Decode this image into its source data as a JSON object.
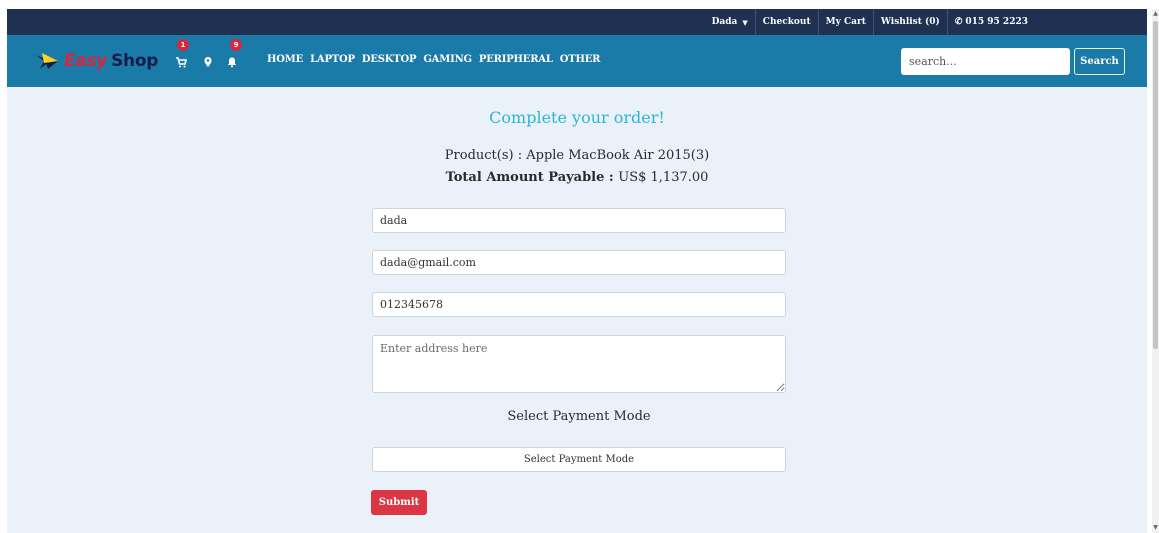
{
  "topbar": {
    "user_label": "Dada",
    "checkout_label": "Checkout",
    "mycart_label": "My Cart",
    "wishlist_label": "Wishlist (0)",
    "phone_label": "015 95 2223"
  },
  "navbar": {
    "logo_easy": "Easy",
    "logo_shop": "Shop",
    "cart_badge": "1",
    "notification_badge": "9",
    "links": [
      "HOME",
      "LAPTOP",
      "DESKTOP",
      "GAMING",
      "PERIPHERAL",
      "OTHER"
    ],
    "search_placeholder": "search...",
    "search_button": "Search"
  },
  "order": {
    "title": "Complete your order!",
    "product_prefix": "Product(s) : ",
    "product_value": "Apple MacBook Air 2015(3)",
    "total_label": "Total Amount Payable : ",
    "total_value": "US$ 1,137.00",
    "name_value": "dada",
    "email_value": "dada@gmail.com",
    "phone_value": "012345678",
    "address_placeholder": "Enter address here",
    "payment_heading": "Select Payment Mode",
    "payment_select": "Select Payment Mode",
    "submit_label": "Submit"
  },
  "colors": {
    "topbar": "#1f3050",
    "navbar": "#1b7ba8",
    "main_bg": "#eaf1f9",
    "title": "#2cb6d4",
    "accent_red": "#dc3545"
  }
}
